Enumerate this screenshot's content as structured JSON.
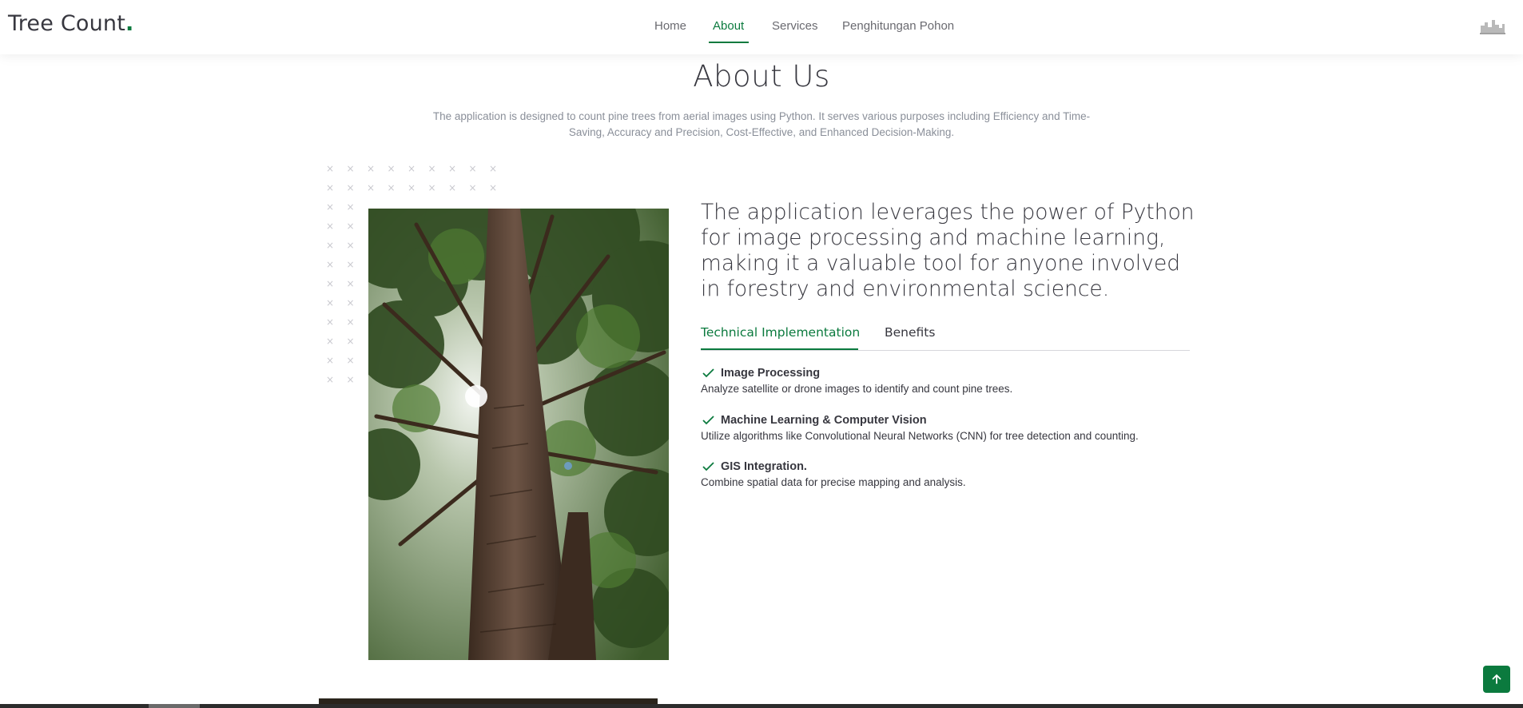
{
  "header": {
    "logo_text": "Tree Count",
    "logo_dot": ".",
    "nav": [
      "Home",
      "About",
      "Services",
      "Penghitungan Pohon"
    ],
    "active_nav": "About",
    "accent": "#0b7a3e"
  },
  "about": {
    "title": "About Us",
    "description": "The application is designed to count pine trees from aerial images using Python. It serves various purposes including Efficiency and Time-Saving, Accuracy and Precision, Cost-Effective, and Enhanced Decision-Making.",
    "lead": "The application leverages the power of Python for image processing and machine learning, making it a valuable tool for anyone involved in forestry and environmental science.",
    "tabs": [
      "Technical Implementation",
      "Benefits"
    ],
    "active_tab": "Technical Implementation",
    "features": [
      {
        "icon": "check-icon",
        "title": "Image Processing",
        "desc": "Analyze satellite or drone images to identify and count pine trees."
      },
      {
        "icon": "check-icon",
        "title": "Machine Learning & Computer Vision",
        "desc": "Utilize algorithms like Convolutional Neural Networks (CNN) for tree detection and counting."
      },
      {
        "icon": "check-icon",
        "title": "GIS Integration.",
        "desc": "Combine spatial data for precise mapping and analysis."
      }
    ]
  },
  "icons": {
    "header_right": "city-skyline-icon",
    "scroll_top": "arrow-up-icon",
    "decoration": "cross-pattern"
  }
}
